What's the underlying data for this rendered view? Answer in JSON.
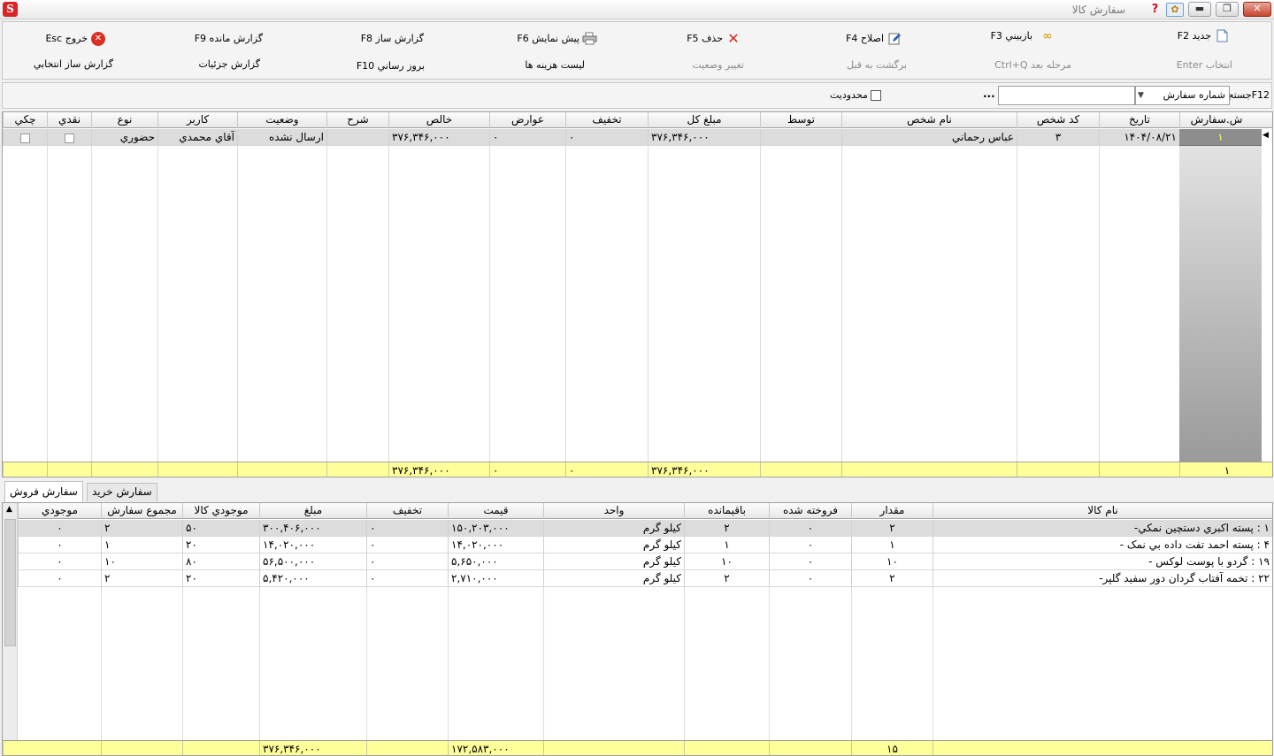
{
  "window": {
    "title": "سفارش كالا"
  },
  "toolbar": {
    "row1": [
      {
        "label": "جديد F2",
        "icon": "new-document-icon"
      },
      {
        "label": "بازبيني F3",
        "icon": "binoculars-icon"
      },
      {
        "label": "اصلاح F4",
        "icon": "edit-pencil-icon"
      },
      {
        "label": "حذف F5",
        "icon": "delete-x-icon"
      },
      {
        "label": "پيش نمايش F6",
        "icon": "printer-icon"
      },
      {
        "label": "گزارش ساز F8",
        "icon": ""
      },
      {
        "label": "گزارش مانده F9",
        "icon": ""
      },
      {
        "label": "خروج Esc",
        "icon": "exit-icon"
      }
    ],
    "row2": [
      {
        "label": "انتخاب Enter",
        "disabled": true
      },
      {
        "label": "مرحله بعد Ctrl+Q",
        "disabled": true
      },
      {
        "label": "برگشت به قبل",
        "disabled": true
      },
      {
        "label": "تغيير وضعيت",
        "disabled": true
      },
      {
        "label": "ليست هزينه ها",
        "disabled": false
      },
      {
        "label": "بروز رساني F10",
        "disabled": false
      },
      {
        "label": "گزارش جزئيات",
        "disabled": false
      },
      {
        "label": "گزارش ساز انتخابي",
        "disabled": false
      }
    ]
  },
  "search": {
    "label": "F12جستجو",
    "field_value": "شماره سفارش",
    "input_value": "",
    "dots": "...",
    "limit_label": "محدوديت"
  },
  "orders": {
    "columns": [
      "ش.سفارش",
      "تاريخ",
      "كد شخص",
      "نام شخص",
      "توسط",
      "مبلغ كل",
      "تخفيف",
      "عوارض",
      "خالص",
      "شرح",
      "وضعيت",
      "كاربر",
      "نوع",
      "نقدي",
      "چكي"
    ],
    "rows": [
      {
        "order_no": "۱",
        "date": "۱۴۰۴/۰۸/۲۱",
        "person_code": "۳",
        "person_name": "عباس رحماني",
        "by": "",
        "total": "۳۷۶,۳۴۶,۰۰۰",
        "discount": "۰",
        "tolls": "۰",
        "net": "۳۷۶,۳۴۶,۰۰۰",
        "desc": "",
        "status": "ارسال نشده",
        "user": "آقاي محمدي",
        "type": "حضوري",
        "cash": false,
        "cheque": false
      }
    ],
    "totals": {
      "count": "۱",
      "total": "۳۷۶,۳۴۶,۰۰۰",
      "discount": "۰",
      "tolls": "۰",
      "net": "۳۷۶,۳۴۶,۰۰۰"
    }
  },
  "tabs": [
    {
      "label": "سفارش فروش",
      "active": true
    },
    {
      "label": "سفارش خريد",
      "active": false
    }
  ],
  "items": {
    "columns": [
      "نام كالا",
      "مقدار",
      "فروخته شده",
      "باقيمانده",
      "واحد",
      "قيمت",
      "تخفيف",
      "مبلغ",
      "موجودي كالا",
      "مجموع سفارش",
      "موجودي"
    ],
    "rows": [
      {
        "name": "۱  :  پسته اكبري دستچين نمكي-",
        "qty": "۲",
        "sold": "۰",
        "remain": "۲",
        "unit": "كيلو گرم",
        "price": "۱۵۰,۲۰۳,۰۰۰",
        "discount": "۰",
        "amount": "۳۰۰,۴۰۶,۰۰۰",
        "stock": "۵۰",
        "order_sum": "۲",
        "balance": "۰"
      },
      {
        "name": "۴  :  پسته احمد تفت داده بي نمک -",
        "qty": "۱",
        "sold": "۰",
        "remain": "۱",
        "unit": "كيلو گرم",
        "price": "۱۴,۰۲۰,۰۰۰",
        "discount": "۰",
        "amount": "۱۴,۰۲۰,۰۰۰",
        "stock": "۲۰",
        "order_sum": "۱",
        "balance": "۰"
      },
      {
        "name": "۱۹  :  گردو با پوست لوکس        -",
        "qty": "۱۰",
        "sold": "۰",
        "remain": "۱۰",
        "unit": "كيلو گرم",
        "price": "۵,۶۵۰,۰۰۰",
        "discount": "۰",
        "amount": "۵۶,۵۰۰,۰۰۰",
        "stock": "۸۰",
        "order_sum": "۱۰",
        "balance": "۰"
      },
      {
        "name": "۲۲  :  تخمه آفتاب گردان دور سفيد گلپر-",
        "qty": "۲",
        "sold": "۰",
        "remain": "۲",
        "unit": "كيلو گرم",
        "price": "۲,۷۱۰,۰۰۰",
        "discount": "۰",
        "amount": "۵,۴۲۰,۰۰۰",
        "stock": "۲۰",
        "order_sum": "۲",
        "balance": "۰"
      }
    ],
    "totals": {
      "qty": "۱۵",
      "price": "۱۷۲,۵۸۳,۰۰۰",
      "amount": "۳۷۶,۳۴۶,۰۰۰"
    }
  }
}
